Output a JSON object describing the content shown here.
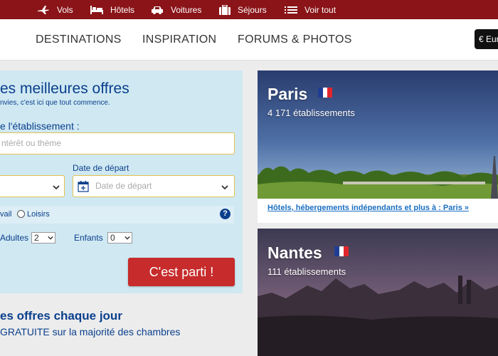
{
  "topnav": {
    "items": [
      {
        "label": "Vols",
        "icon": "plane-icon"
      },
      {
        "label": "Hôtels",
        "icon": "bed-icon"
      },
      {
        "label": "Voitures",
        "icon": "car-icon"
      },
      {
        "label": "Séjours",
        "icon": "suitcase-icon"
      },
      {
        "label": "Voir tout",
        "icon": "list-icon"
      }
    ]
  },
  "mainnav": {
    "items": [
      "DESTINATIONS",
      "INSPIRATION",
      "FORUMS & PHOTOS"
    ],
    "currency": "€ Eur"
  },
  "search": {
    "title": "es meilleures offres",
    "subtitle": "nvies, c'est ici que tout commence.",
    "destination_label": "e l'établissement :",
    "destination_placeholder": "ntérêt ou thème",
    "departure_label": "Date de départ",
    "departure_placeholder": "Date de départ",
    "trip_type_work": "vail",
    "trip_type_leisure": "Loisirs",
    "help": "?",
    "adults_label": "Adultes",
    "adults_value": "2",
    "children_label": "Enfants",
    "children_value": "0",
    "submit_label": "C'est parti !"
  },
  "promo": {
    "title": "es offres chaque jour",
    "subtitle_bold": "GRATUITE",
    "subtitle_rest": " sur la majorité des chambres"
  },
  "destinations": [
    {
      "city": "Paris",
      "count": "4 171 établissements",
      "link": "Hôtels, hébergements indépendants et plus à : Paris »"
    },
    {
      "city": "Nantes",
      "count": "111 établissements"
    }
  ],
  "colors": {
    "topbar": "#8a1418",
    "brand_blue": "#0a3f8c",
    "panel": "#cfe8f2",
    "button_red": "#c72b2b",
    "link_blue": "#1a6fc2",
    "field_border": "#e1c24e"
  }
}
